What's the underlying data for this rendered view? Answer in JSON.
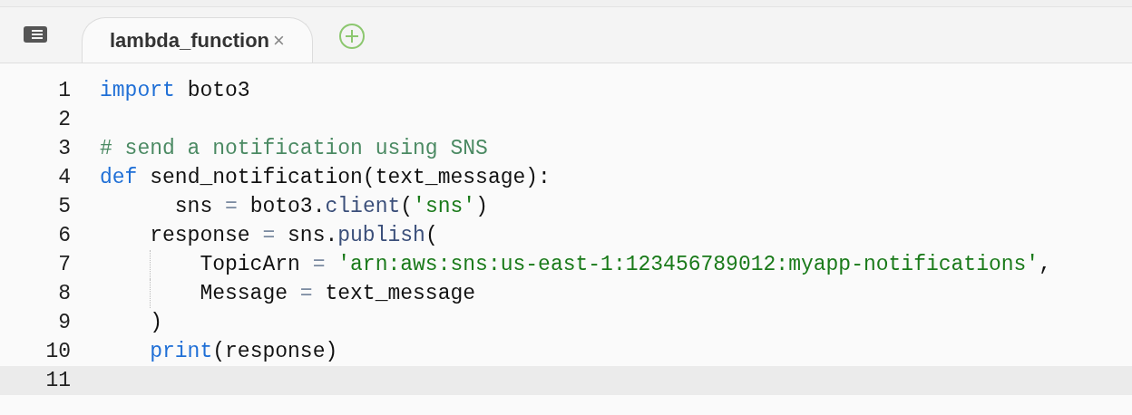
{
  "tabs": [
    {
      "label": "lambda_function",
      "selected": true,
      "close": "×"
    }
  ],
  "lines": [
    {
      "number": "1",
      "active": false,
      "kind": "flat",
      "tokens": [
        {
          "kind": "keyword",
          "text": "import"
        },
        {
          "kind": "plain",
          "text": " boto3"
        }
      ]
    },
    {
      "number": "2",
      "active": false,
      "kind": "flat"
    },
    {
      "number": "3",
      "active": false,
      "kind": "flat",
      "tokens": [
        {
          "kind": "comment",
          "text": "# send a notification using SNS"
        }
      ]
    },
    {
      "number": "4",
      "active": false,
      "kind": "flat",
      "tokens": [
        {
          "kind": "keyword",
          "text": "def"
        },
        {
          "kind": "plain",
          "text": " send_notification(text_message):"
        }
      ]
    },
    {
      "number": "5",
      "active": false,
      "kind": "offset",
      "tokens": [
        {
          "kind": "plain",
          "text": "sns "
        },
        {
          "kind": "operator",
          "text": "="
        },
        {
          "kind": "plain",
          "text": " boto3."
        },
        {
          "kind": "method",
          "text": "client"
        },
        {
          "kind": "plain",
          "text": "("
        },
        {
          "kind": "string",
          "text": "'sns'"
        },
        {
          "kind": "plain",
          "text": ")"
        }
      ]
    },
    {
      "number": "6",
      "active": false,
      "kind": "indented",
      "tokens": [
        {
          "kind": "plain",
          "text": "response "
        },
        {
          "kind": "operator",
          "text": "="
        },
        {
          "kind": "plain",
          "text": " sns."
        },
        {
          "kind": "method",
          "text": "publish"
        },
        {
          "kind": "plain",
          "text": "("
        }
      ]
    },
    {
      "number": "7",
      "active": false,
      "kind": "nested",
      "tokens": [
        {
          "kind": "plain",
          "text": "TopicArn "
        },
        {
          "kind": "operator",
          "text": "= "
        },
        {
          "kind": "string",
          "text": "'arn:aws:sns:us-east-1:123456789012:myapp-notifications'"
        },
        {
          "kind": "plain",
          "text": ","
        }
      ]
    },
    {
      "number": "8",
      "active": false,
      "kind": "nested",
      "tokens": [
        {
          "kind": "plain",
          "text": "Message "
        },
        {
          "kind": "operator",
          "text": "="
        },
        {
          "kind": "plain",
          "text": " text_message"
        }
      ]
    },
    {
      "number": "9",
      "active": false,
      "kind": "indented",
      "tokens": [
        {
          "kind": "plain",
          "text": ")"
        }
      ]
    },
    {
      "number": "10",
      "active": false,
      "kind": "indented",
      "tokens": [
        {
          "kind": "keyword",
          "text": "print"
        },
        {
          "kind": "plain",
          "text": "(response)"
        }
      ]
    },
    {
      "number": "11",
      "active": true,
      "kind": "flat"
    }
  ]
}
